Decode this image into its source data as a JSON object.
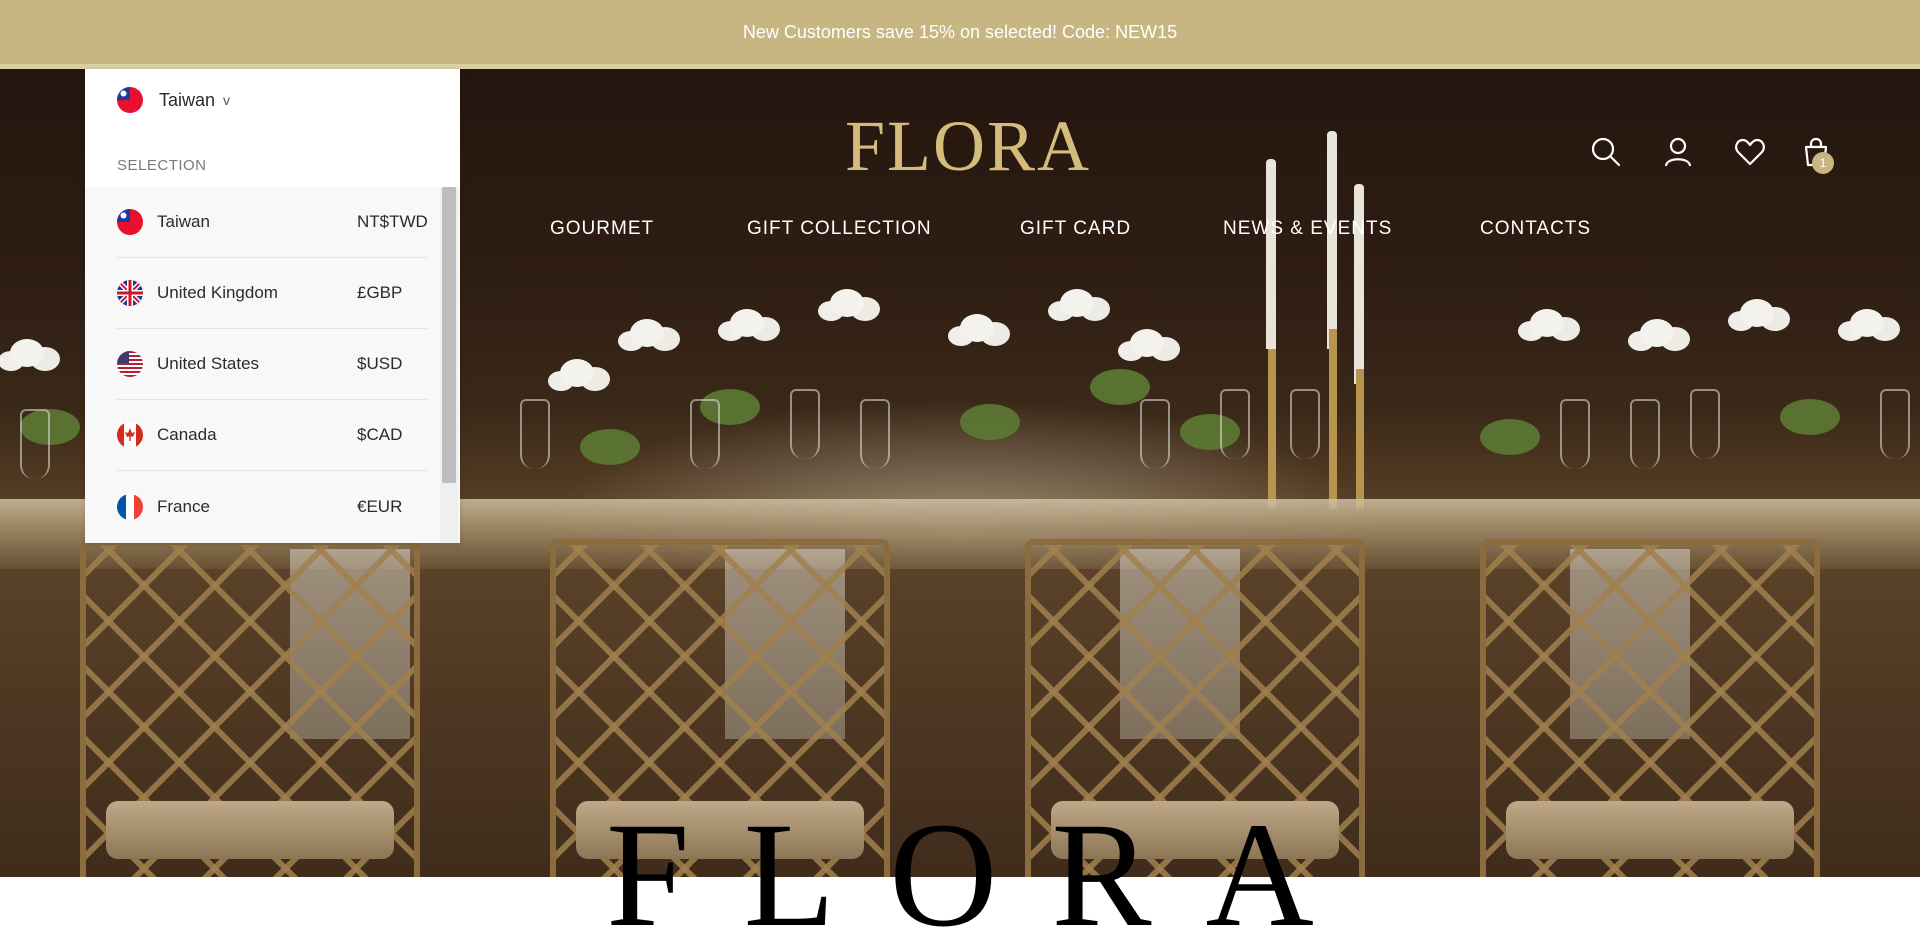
{
  "announcement": {
    "text": "New Customers save 15% on selected! Code: NEW15"
  },
  "header": {
    "logo": "FLORA",
    "icons": [
      "search-icon",
      "user-icon",
      "heart-icon",
      "shopping-bag-icon"
    ],
    "cart_count": "1"
  },
  "nav": {
    "items": [
      {
        "label": "GOURMET"
      },
      {
        "label": "GIFT COLLECTION"
      },
      {
        "label": "GIFT CARD"
      },
      {
        "label": "NEWS & EVENTS"
      },
      {
        "label": "CONTACTS"
      }
    ]
  },
  "hero": {
    "big_title": "FLORA"
  },
  "country_selector": {
    "current": "Taiwan",
    "chevron": "v",
    "section_label": "SELECTION",
    "options": [
      {
        "country": "Taiwan",
        "currency": "NT$TWD",
        "flag": "taiwan-flag-icon"
      },
      {
        "country": "United Kingdom",
        "currency": "£GBP",
        "flag": "uk-flag-icon"
      },
      {
        "country": "United States",
        "currency": "$USD",
        "flag": "us-flag-icon"
      },
      {
        "country": "Canada",
        "currency": "$CAD",
        "flag": "canada-flag-icon"
      },
      {
        "country": "France",
        "currency": "€EUR",
        "flag": "france-flag-icon"
      }
    ]
  },
  "colors": {
    "announcement_bg": "#c7b682",
    "logo_gold": "#d6bc7c",
    "dropdown_bg": "#ffffff"
  }
}
